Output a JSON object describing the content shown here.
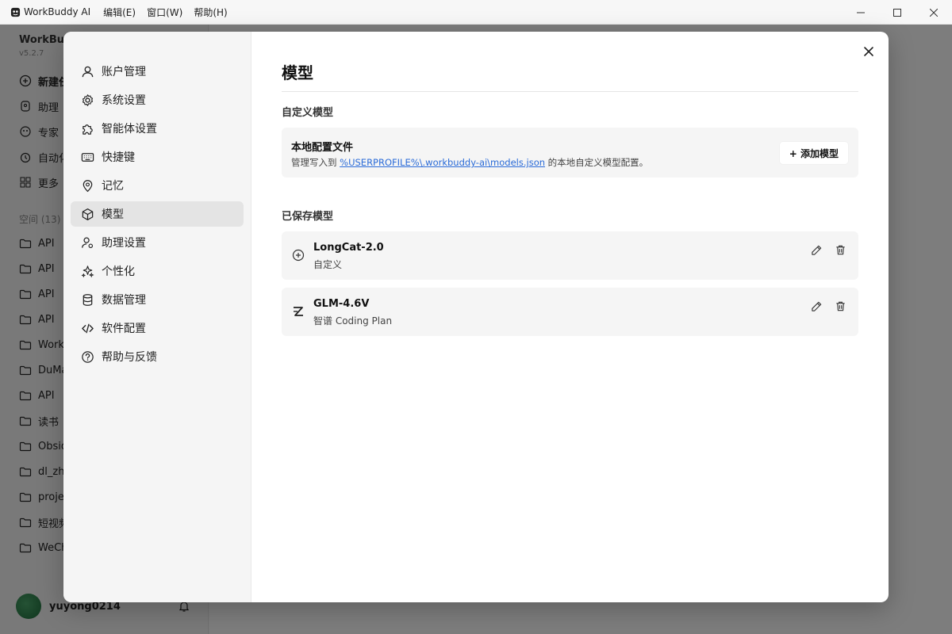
{
  "titlebar": {
    "app_title": "WorkBuddy AI",
    "menus": [
      "编辑(E)",
      "窗口(W)",
      "帮助(H)"
    ]
  },
  "background": {
    "brand": "WorkBuddy",
    "version": "v5.2.7",
    "nav": [
      "新建任务",
      "助理",
      "专家",
      "自动化",
      "更多"
    ],
    "section": "空间 (13)",
    "folders": [
      "API",
      "API",
      "API",
      "API",
      "Work",
      "DuMa",
      "API",
      "读书",
      "Obsid",
      "dl_zhe",
      "proje",
      "短视频",
      "WeCh"
    ],
    "username": "yuyong0214"
  },
  "settings_nav": {
    "items": [
      {
        "label": "账户管理",
        "icon": "user-icon"
      },
      {
        "label": "系统设置",
        "icon": "gear-icon"
      },
      {
        "label": "智能体设置",
        "icon": "puzzle-icon"
      },
      {
        "label": "快捷键",
        "icon": "keyboard-icon"
      },
      {
        "label": "记忆",
        "icon": "memory-icon"
      },
      {
        "label": "模型",
        "icon": "cube-icon",
        "active": true
      },
      {
        "label": "助理设置",
        "icon": "user-gear-icon"
      },
      {
        "label": "个性化",
        "icon": "sparkle-icon"
      },
      {
        "label": "数据管理",
        "icon": "database-icon"
      },
      {
        "label": "软件配置",
        "icon": "code-icon"
      },
      {
        "label": "帮助与反馈",
        "icon": "help-icon"
      }
    ]
  },
  "page": {
    "title": "模型",
    "custom_section": "自定义模型",
    "config": {
      "title": "本地配置文件",
      "desc_prefix": "管理写入到 ",
      "path": "%USERPROFILE%\\.workbuddy-ai\\models.json",
      "desc_suffix": " 的本地自定义模型配置。",
      "add_button": "+ 添加模型"
    },
    "saved_section": "已保存模型",
    "models": [
      {
        "name": "LongCat-2.0",
        "provider": "自定义",
        "icon": "plus-circle-icon"
      },
      {
        "name": "GLM-4.6V",
        "provider": "智谱 Coding Plan",
        "icon": "zhipu-logo-icon"
      }
    ]
  },
  "colors": {
    "accent_link": "#2a6bd8",
    "active_nav_bg": "#e4e4e4",
    "card_bg": "#f5f5f5"
  }
}
